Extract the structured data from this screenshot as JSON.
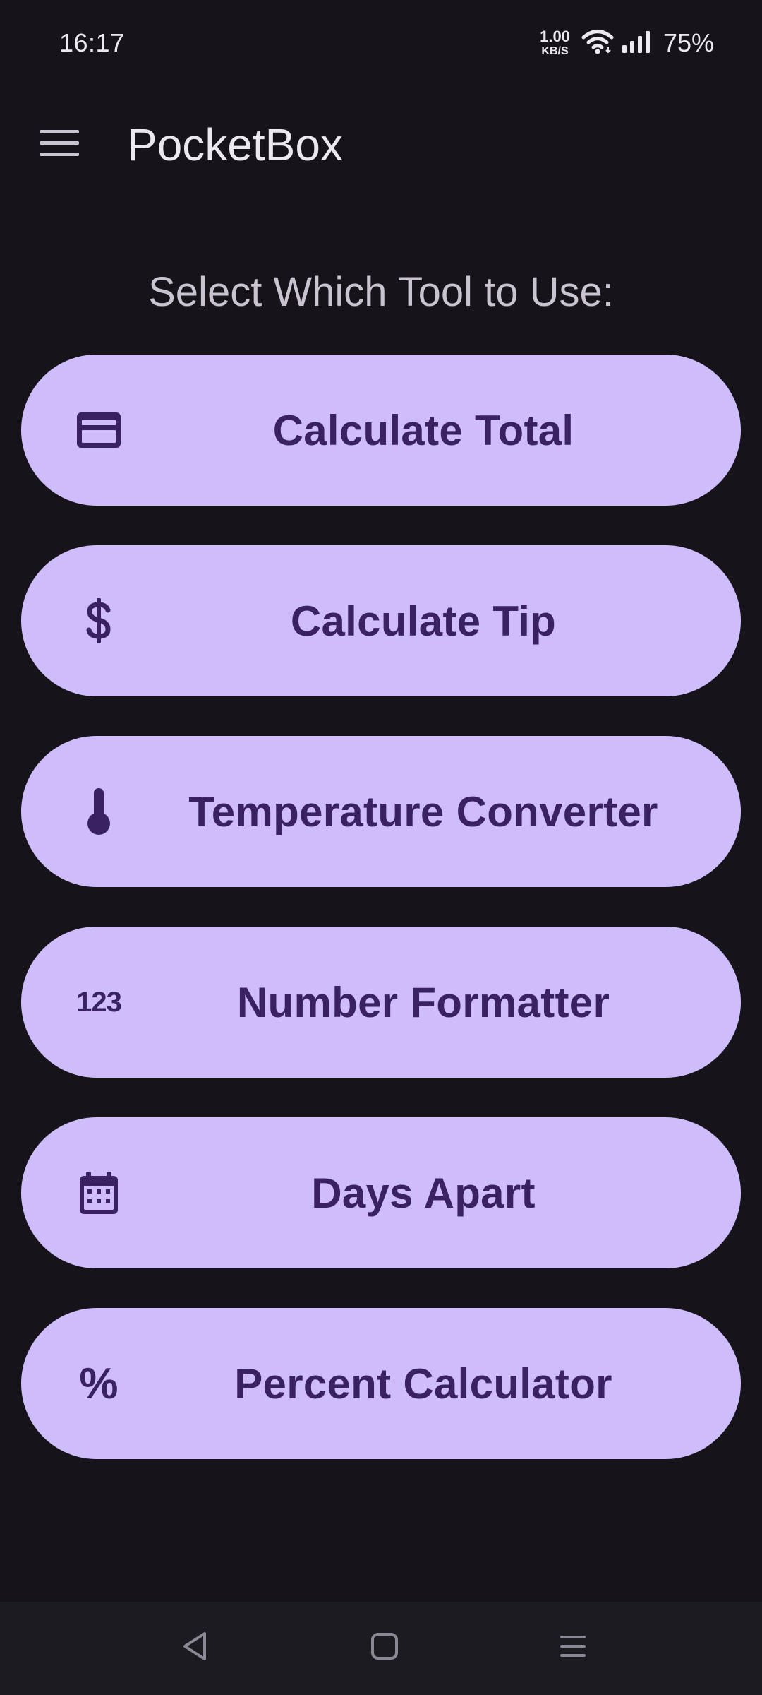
{
  "status_bar": {
    "time": "16:17",
    "net_speed_value": "1.00",
    "net_speed_unit": "KB/S",
    "battery": "75%"
  },
  "app_bar": {
    "title": "PocketBox",
    "menu_icon": "hamburger-menu-icon"
  },
  "heading": "Select Which Tool to Use:",
  "tools": [
    {
      "label": "Calculate Total",
      "icon": "credit-card-icon"
    },
    {
      "label": "Calculate Tip",
      "icon": "dollar-sign-icon"
    },
    {
      "label": "Temperature Converter",
      "icon": "thermometer-icon"
    },
    {
      "label": "Number Formatter",
      "icon": "numbers-123-icon",
      "icon_text": "123"
    },
    {
      "label": "Days Apart",
      "icon": "calendar-icon"
    },
    {
      "label": "Percent Calculator",
      "icon": "percent-icon",
      "icon_text": "%"
    }
  ],
  "nav": {
    "back": "back-icon",
    "home": "home-icon",
    "recents": "recents-icon"
  },
  "colors": {
    "background": "#16141a",
    "button_fill": "#cfbdfb",
    "button_text": "#3a2262",
    "heading_text": "#cac4d0"
  }
}
